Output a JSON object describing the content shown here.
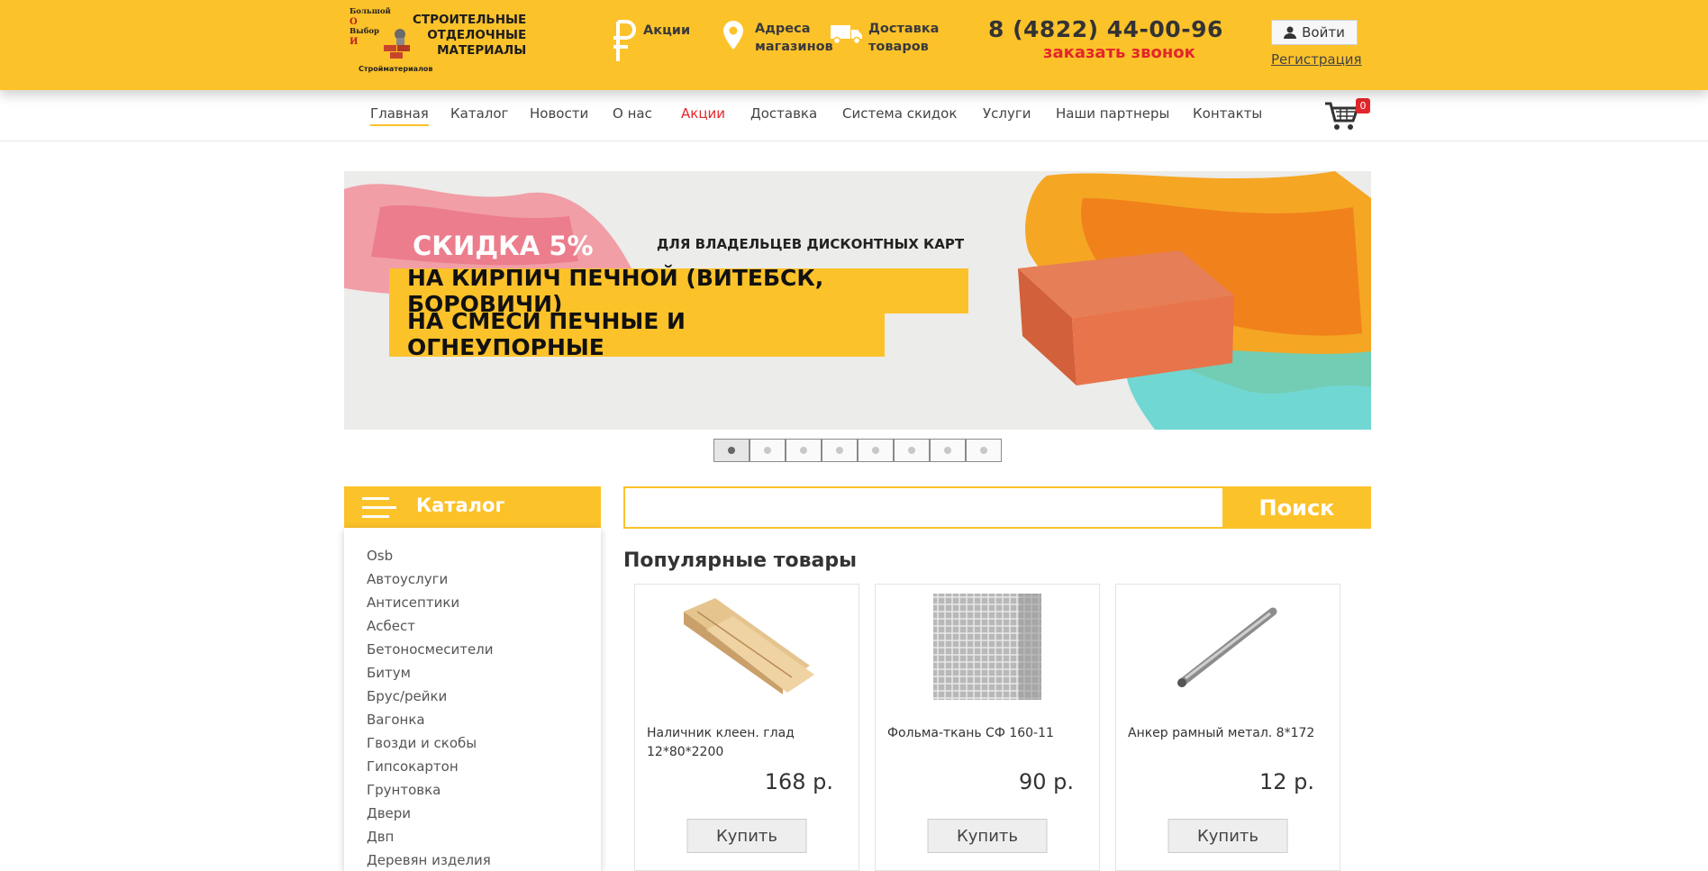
{
  "header": {
    "logo": {
      "left_letters": [
        "Большой",
        "О",
        "Выбор",
        "И",
        "Строиматериалов"
      ],
      "right_lines": [
        "СТРОИТЕЛЬНЫЕ",
        "ОТДЕЛОЧНЫЕ",
        "МАТЕРИАЛЫ"
      ],
      "under": "Стройматериалов"
    },
    "promo_label": "Акции",
    "stores_label_1": "Адреса",
    "stores_label_2": "магазинов",
    "delivery_label_1": "Доставка",
    "delivery_label_2": "товаров",
    "phone": "8 (4822) 44-00-96",
    "callback": "заказать звонок",
    "login": "Войти",
    "register": "Регистрация",
    "icons": [
      "ruble-icon",
      "map-pin-icon",
      "truck-icon",
      "user-icon"
    ]
  },
  "nav": {
    "items": [
      "Главная",
      "Каталог",
      "Новости",
      "О нас",
      "Акции",
      "Доставка",
      "Система скидок",
      "Услуги",
      "Наши партнеры",
      "Контакты"
    ],
    "cart_count": "0"
  },
  "banner": {
    "discount": "СКИДКА 5%",
    "holders": "ДЛЯ ВЛАДЕЛЬЦЕВ ДИСКОНТНЫХ КАРТ",
    "line1": "НА КИРПИЧ ПЕЧНОЙ (ВИТЕБСК, БОРОВИЧИ)",
    "line2": "НА СМЕСИ ПЕЧНЫЕ И ОГНЕУПОРНЫЕ",
    "slide_count": 8,
    "active_slide": 1
  },
  "catalog": {
    "title": "Каталог",
    "items": [
      "Osb",
      "Автоуслуги",
      "Антисептики",
      "Асбест",
      "Бетоносмесители",
      "Битум",
      "Брус/рейки",
      "Вагонка",
      "Гвозди и скобы",
      "Гипсокартон",
      "Грунтовка",
      "Двери",
      "Двп",
      "Деревян изделия"
    ]
  },
  "search": {
    "placeholder": "",
    "button": "Поиск"
  },
  "popular": {
    "title": "Популярные товары",
    "products": [
      {
        "name": "Наличник клеен. глад 12*80*2200",
        "price": "168 р.",
        "buy": "Купить"
      },
      {
        "name": "Фольма-ткань СФ 160-11",
        "price": "90 р.",
        "buy": "Купить"
      },
      {
        "name": "Анкер рамный метал. 8*172",
        "price": "12 р.",
        "buy": "Купить"
      }
    ]
  },
  "colors": {
    "accent": "#fcc22a",
    "red": "#e3262b"
  }
}
